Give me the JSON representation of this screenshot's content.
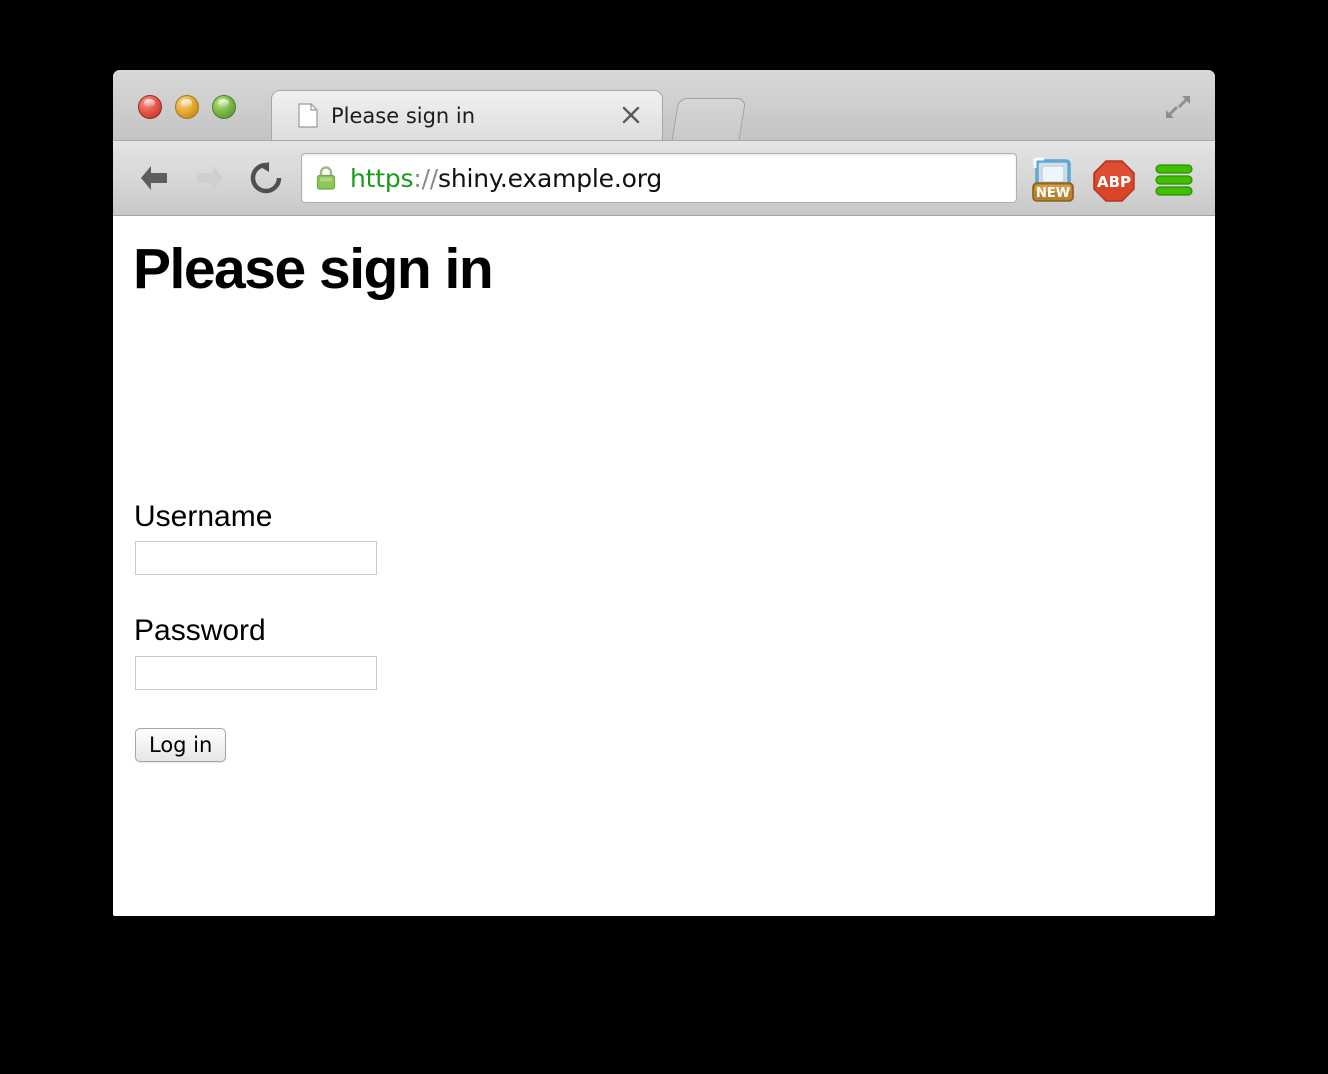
{
  "window": {
    "traffic_lights": {
      "close_label": "Close",
      "minimize_label": "Minimize",
      "zoom_label": "Zoom"
    },
    "expand_label": "Enter Full Screen"
  },
  "tabs": [
    {
      "title": "Please sign in",
      "favicon": "document-icon",
      "close_label": "×",
      "active": true
    }
  ],
  "newtab": {
    "label": "+"
  },
  "toolbar": {
    "back_label": "Back",
    "forward_label": "Forward",
    "reload_label": "Reload",
    "url": {
      "scheme": "https",
      "separator": "://",
      "host": "shiny.example.org",
      "full": "https://shiny.example.org",
      "secure": true,
      "lock_color": "#7cc143"
    },
    "extensions": [
      {
        "name": "screenshot-new-extension",
        "badge": "NEW",
        "color": "#5aa9d6"
      },
      {
        "name": "adblock-plus-extension",
        "label": "ABP",
        "color": "#d9452b"
      },
      {
        "name": "menu-extension",
        "label": "Menu",
        "color": "#3fbf00"
      }
    ]
  },
  "page": {
    "heading": "Please sign in",
    "fields": [
      {
        "label": "Username",
        "value": "",
        "placeholder": "",
        "type": "text"
      },
      {
        "label": "Password",
        "value": "",
        "placeholder": "",
        "type": "password"
      }
    ],
    "submit_label": "Log in"
  },
  "colors": {
    "background": "#000000",
    "chrome": "#d6d6d6",
    "content": "#ffffff",
    "accent_green": "#1a9a1a"
  }
}
